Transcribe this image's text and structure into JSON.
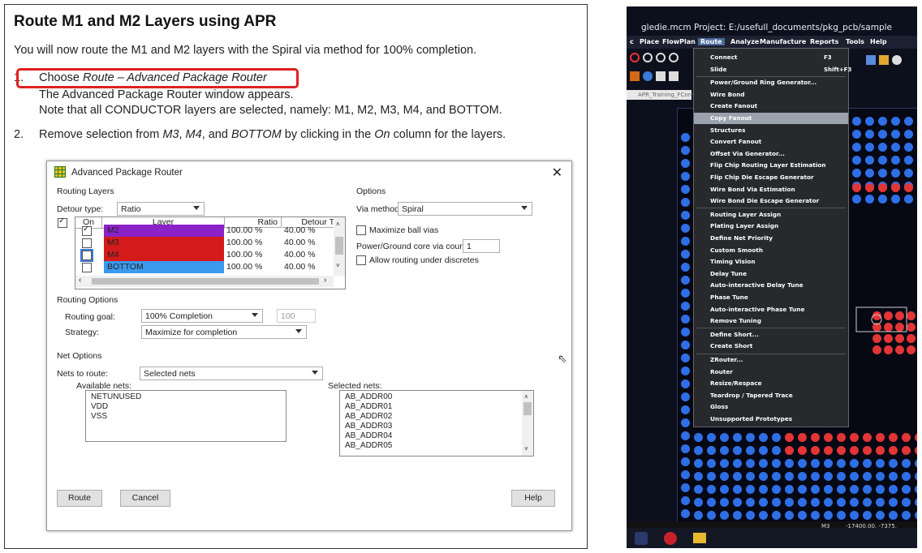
{
  "doc": {
    "title": "Route M1 and M2 Layers using APR",
    "intro": "You will now route the M1 and M2 layers with the Spiral via method for 100% completion.",
    "step1": {
      "num": "1.",
      "text_prefix": "Choose ",
      "text_italic": "Route – Advanced Package Router"
    },
    "step1_line2": "The Advanced Package Router window appears.",
    "step1_line3": "Note that all CONDUCTOR layers are selected, namely: M1, M2, M3, M4, and BOTTOM.",
    "step2": {
      "num": "2.",
      "t1": "Remove selection from ",
      "i1": "M3",
      "t2": ", ",
      "i2": "M4",
      "t3": ", and ",
      "i3": "BOTTOM",
      "t4": " by clicking in the ",
      "i4": "On",
      "t5": " column for the layers."
    },
    "highlight_color": "#e02020"
  },
  "dialog": {
    "title": "Advanced Package Router",
    "close": "✕",
    "routing_layers": {
      "group": "Routing Layers",
      "detour_label": "Detour type:",
      "detour_value": "Ratio",
      "columns": [
        "On",
        "Layer",
        "Ratio",
        "Detour Tol"
      ],
      "rows": [
        {
          "layer": "M2",
          "color": "#8b22c8",
          "ratio": "100.00 %",
          "tol": "40.00 %",
          "on": true
        },
        {
          "layer": "M3",
          "color": "#d41a1a",
          "ratio": "100.00 %",
          "tol": "40.00 %",
          "on": false
        },
        {
          "layer": "M4",
          "color": "#d41a1a",
          "ratio": "100.00 %",
          "tol": "40.00 %",
          "on": false
        },
        {
          "layer": "BOTTOM",
          "color": "#3c9aee",
          "ratio": "100.00 %",
          "tol": "40.00 %",
          "on": false
        }
      ]
    },
    "options": {
      "group": "Options",
      "via_label": "Via method:",
      "via_value": "Spiral",
      "max_ball_vias": "Maximize ball vias",
      "pg_core_label": "Power/Ground core via count:",
      "pg_core_value": "1",
      "allow_discretes": "Allow routing under discretes"
    },
    "routing_options": {
      "group": "Routing Options",
      "goal_label": "Routing goal:",
      "goal_value": "100% Completion",
      "goal_number": "100",
      "strategy_label": "Strategy:",
      "strategy_value": "Maximize for completion"
    },
    "net_options": {
      "group": "Net Options",
      "nets_label": "Nets to route:",
      "nets_value": "Selected nets",
      "available_label": "Available nets:",
      "available": [
        "NETUNUSED",
        "VDD",
        "VSS"
      ],
      "selected_label": "Selected nets:",
      "selected": [
        "AB_ADDR00",
        "AB_ADDR01",
        "AB_ADDR02",
        "AB_ADDR03",
        "AB_ADDR04",
        "AB_ADDR05"
      ]
    },
    "buttons": {
      "route": "Route",
      "cancel": "Cancel",
      "help": "Help"
    }
  },
  "photo": {
    "title": "gledie.mcm  Project: E:/usefull_documents/pkg_pcb/sample",
    "menubar": [
      "c",
      "Place",
      "FlowPlan",
      "Route",
      "Analyze",
      "Manufacture",
      "Reports",
      "Tools",
      "Help"
    ],
    "tab_label": "APR_Training_FCons",
    "menu_items": [
      {
        "label": "Connect",
        "key": "F3"
      },
      {
        "label": "Slide",
        "key": "Shift+F3"
      },
      {
        "label": "Power/Ground Ring Generator..."
      },
      {
        "label": "Wire Bond",
        "sub": "▸"
      },
      {
        "label": "Create Fanout"
      },
      {
        "label": "Copy Fanout",
        "selected": true
      },
      {
        "label": "Structures",
        "sub": "▸"
      },
      {
        "label": "Convert Fanout",
        "sub": "▸"
      },
      {
        "label": "Offset Via Generator..."
      },
      {
        "label": "Flip Chip Routing Layer Estimation"
      },
      {
        "label": "Flip Chip Die Escape Generator"
      },
      {
        "label": "Wire Bond Via Estimation"
      },
      {
        "label": "Wire Bond Die Escape Generator"
      },
      {
        "label": "Routing Layer Assign"
      },
      {
        "label": "Plating Layer Assign"
      },
      {
        "label": "Define Net Priority"
      },
      {
        "label": "Custom Smooth"
      },
      {
        "label": "Timing Vision"
      },
      {
        "label": "Delay Tune"
      },
      {
        "label": "Auto-interactive Delay Tune"
      },
      {
        "label": "Phase Tune"
      },
      {
        "label": "Auto-interactive Phase Tune"
      },
      {
        "label": "Remove Tuning"
      },
      {
        "label": "Define Short..."
      },
      {
        "label": "Create Short"
      },
      {
        "label": "ZRouter..."
      },
      {
        "label": "Router",
        "sub": "▸"
      },
      {
        "label": "Resize/Respace",
        "sub": "▸"
      },
      {
        "label": "Teardrop / Tapered Trace",
        "sub": "▸"
      },
      {
        "label": "Gloss",
        "sub": "▸"
      },
      {
        "label": "Unsupported Prototypes",
        "sub": "▸"
      }
    ],
    "status_layer": "M3",
    "status_coords": "-17400.00, -7375."
  }
}
